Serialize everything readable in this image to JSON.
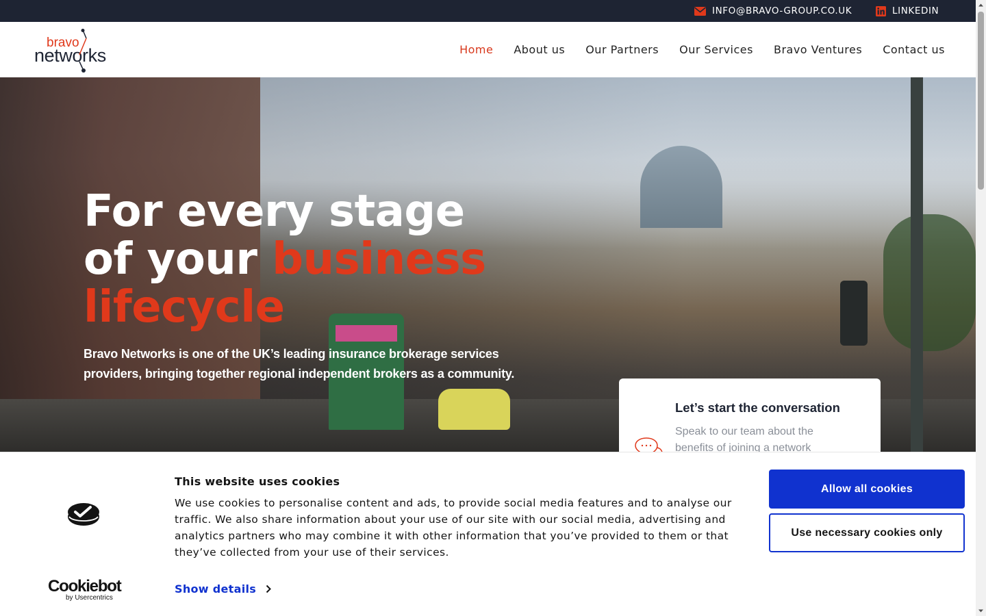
{
  "topbar": {
    "email_label": "INFO@BRAVO-GROUP.CO.UK",
    "linkedin_label": "LINKEDIN"
  },
  "logo": {
    "line1": "bravo",
    "line2": "networks"
  },
  "nav": {
    "items": [
      {
        "label": "Home",
        "active": true
      },
      {
        "label": "About us"
      },
      {
        "label": "Our Partners"
      },
      {
        "label": "Our Services"
      },
      {
        "label": "Bravo Ventures"
      },
      {
        "label": "Contact us"
      }
    ]
  },
  "hero": {
    "headline_line1": "For every stage",
    "headline_line2_plain": "of your ",
    "headline_line2_accent": "business",
    "headline_line3_accent": "lifecycle",
    "lede": "Bravo Networks is one of the UK’s leading insurance brokerage services providers, bringing together regional independent brokers as a community.",
    "accent_color": "#e0391b"
  },
  "card": {
    "title": "Let’s start the conversation",
    "text": "Speak to our team about the benefits of joining a network"
  },
  "cookie": {
    "title": "This website uses cookies",
    "text": "We use cookies to personalise content and ads, to provide social media features and to analyse our traffic. We also share information about your use of our site with our social media, advertising and analytics partners who may combine it with other information that you’ve provided to them or that they’ve collected from your use of their services.",
    "details_label": "Show details",
    "allow_all_label": "Allow all cookies",
    "necessary_label": "Use necessary cookies only",
    "brand_name": "Cookiebot",
    "brand_sub": "by Usercentrics",
    "button_color": "#1032cf"
  }
}
